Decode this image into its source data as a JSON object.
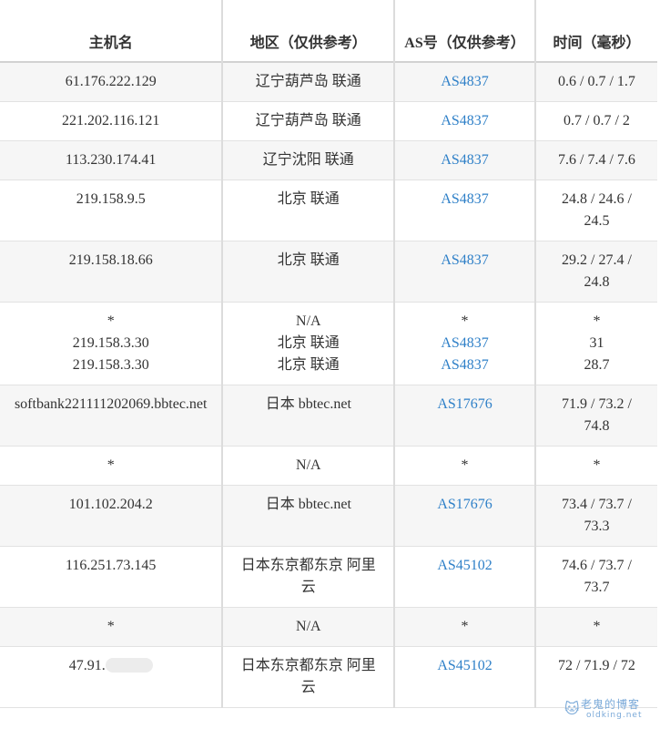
{
  "table": {
    "headers": {
      "host": "主机名",
      "region": "地区（仅供参考）",
      "as": "AS号（仅供参考）",
      "time": "时间（毫秒）"
    },
    "rows": [
      {
        "host": [
          "61.176.222.129"
        ],
        "region": [
          "辽宁葫芦岛 联通"
        ],
        "as": [
          "AS4837"
        ],
        "time": [
          "0.6 / 0.7 / 1.7"
        ]
      },
      {
        "host": [
          "221.202.116.121"
        ],
        "region": [
          "辽宁葫芦岛 联通"
        ],
        "as": [
          "AS4837"
        ],
        "time": [
          "0.7 / 0.7 / 2"
        ]
      },
      {
        "host": [
          "113.230.174.41"
        ],
        "region": [
          "辽宁沈阳 联通"
        ],
        "as": [
          "AS4837"
        ],
        "time": [
          "7.6 / 7.4 / 7.6"
        ]
      },
      {
        "host": [
          "219.158.9.5"
        ],
        "region": [
          "北京 联通"
        ],
        "as": [
          "AS4837"
        ],
        "time": [
          "24.8 / 24.6 /",
          "24.5"
        ]
      },
      {
        "host": [
          "219.158.18.66"
        ],
        "region": [
          "北京 联通"
        ],
        "as": [
          "AS4837"
        ],
        "time": [
          "29.2 / 27.4 /",
          "24.8"
        ]
      },
      {
        "host": [
          "*",
          "219.158.3.30",
          "219.158.3.30"
        ],
        "region": [
          "N/A",
          "北京 联通",
          "北京 联通"
        ],
        "as": [
          "*",
          "AS4837",
          "AS4837"
        ],
        "time": [
          "*",
          "31",
          "28.7"
        ]
      },
      {
        "host": [
          "softbank221111202069.bbtec.net"
        ],
        "region": [
          "日本 bbtec.net"
        ],
        "as": [
          "AS17676"
        ],
        "time": [
          "71.9 / 73.2 /",
          "74.8"
        ]
      },
      {
        "host": [
          "*"
        ],
        "region": [
          "N/A"
        ],
        "as": [
          "*"
        ],
        "time": [
          "*"
        ]
      },
      {
        "host": [
          "101.102.204.2"
        ],
        "region": [
          "日本 bbtec.net"
        ],
        "as": [
          "AS17676"
        ],
        "time": [
          "73.4 / 73.7 /",
          "73.3"
        ]
      },
      {
        "host": [
          "116.251.73.145"
        ],
        "region": [
          "日本东京都东京 阿里",
          "云"
        ],
        "as": [
          "AS45102"
        ],
        "time": [
          "74.6 / 73.7 /",
          "73.7"
        ]
      },
      {
        "host": [
          "*"
        ],
        "region": [
          "N/A"
        ],
        "as": [
          "*"
        ],
        "time": [
          "*"
        ]
      },
      {
        "host": [
          "47.91."
        ],
        "region": [
          "日本东京都东京 阿里",
          "云"
        ],
        "as": [
          "AS45102"
        ],
        "time": [
          "72 / 71.9 / 72"
        ]
      }
    ],
    "last_host_redacted": true
  },
  "watermark": {
    "title": "老鬼的博客",
    "subtitle": "oldking.net",
    "icon": "cat-logo-icon"
  },
  "colors": {
    "link": "#2f80c8",
    "stripe": "#f6f6f6",
    "text": "#333333"
  }
}
